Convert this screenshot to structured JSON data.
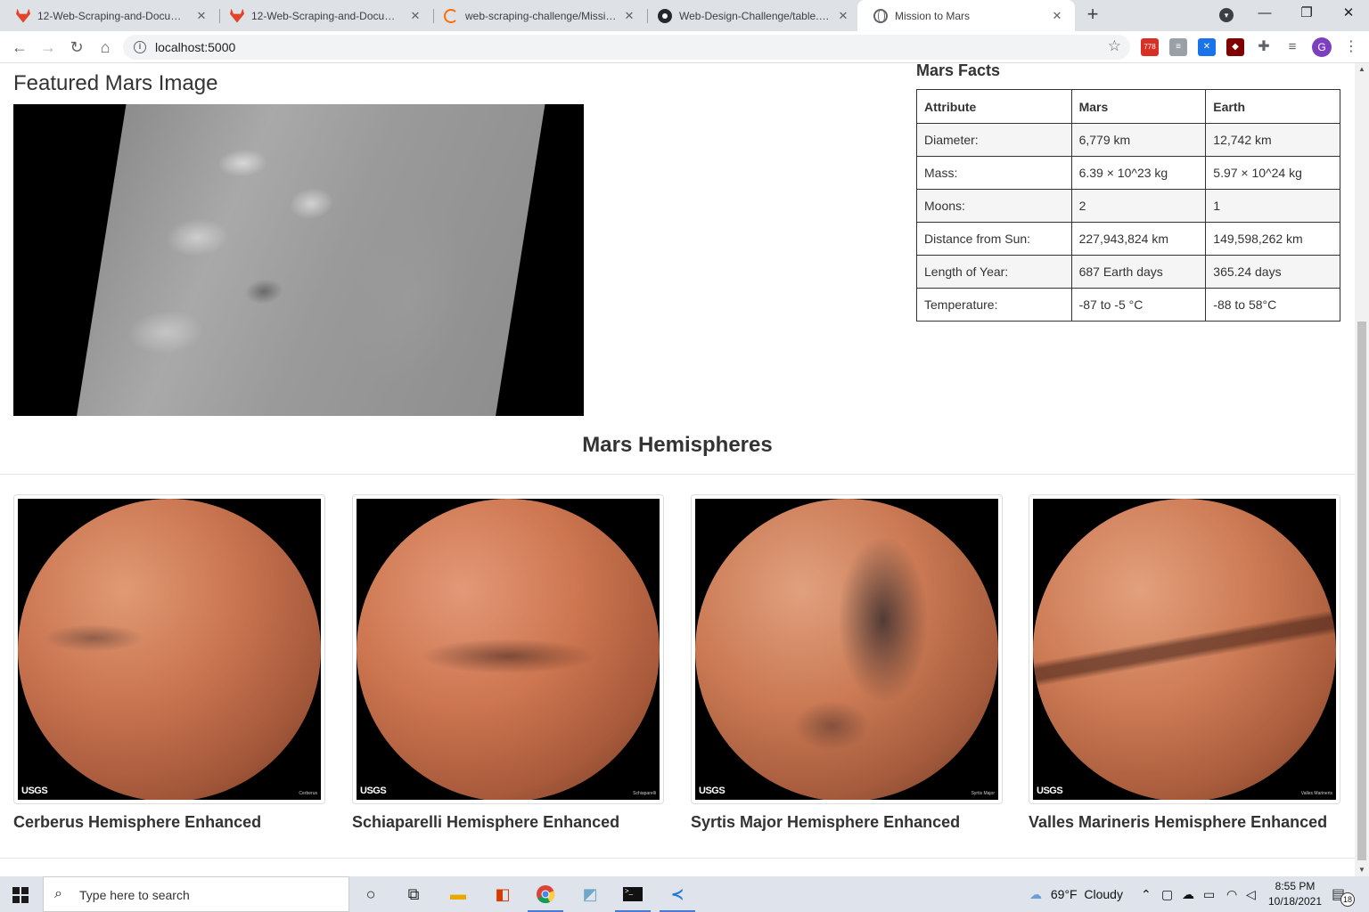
{
  "browser": {
    "tabs": [
      {
        "title": "12-Web-Scraping-and-Documen",
        "icon": "gitlab-icon",
        "active": false
      },
      {
        "title": "12-Web-Scraping-and-Documen",
        "icon": "gitlab-icon",
        "active": false
      },
      {
        "title": "web-scraping-challenge/Mission",
        "icon": "loading-spinner-icon",
        "active": false
      },
      {
        "title": "Web-Design-Challenge/table.htm",
        "icon": "github-icon",
        "active": false
      },
      {
        "title": "Mission to Mars",
        "icon": "globe-icon",
        "active": true
      }
    ],
    "url": "localhost:5000",
    "extension_badge": "778",
    "profile_initial": "G"
  },
  "page": {
    "featured": {
      "title": "Featured Mars Image"
    },
    "facts": {
      "title": "Mars Facts",
      "headers": [
        "Attribute",
        "Mars",
        "Earth"
      ],
      "rows": [
        [
          "Diameter:",
          "6,779 km",
          "12,742 km"
        ],
        [
          "Mass:",
          "6.39 × 10^23 kg",
          "5.97 × 10^24 kg"
        ],
        [
          "Moons:",
          "2",
          "1"
        ],
        [
          "Distance from Sun:",
          "227,943,824 km",
          "149,598,262 km"
        ],
        [
          "Length of Year:",
          "687 Earth days",
          "365.24 days"
        ],
        [
          "Temperature:",
          "-87 to -5 °C",
          "-88 to 58°C"
        ]
      ]
    },
    "hemispheres": {
      "title": "Mars Hemispheres",
      "items": [
        {
          "caption": "Cerberus Hemisphere Enhanced",
          "logo": "USGS",
          "credit": "Cerberus"
        },
        {
          "caption": "Schiaparelli Hemisphere Enhanced",
          "logo": "USGS",
          "credit": "Schiaparelli"
        },
        {
          "caption": "Syrtis Major Hemisphere Enhanced",
          "logo": "USGS",
          "credit": "Syrtis Major"
        },
        {
          "caption": "Valles Marineris Hemisphere Enhanced",
          "logo": "USGS",
          "credit": "Valles Marineris"
        }
      ]
    }
  },
  "taskbar": {
    "search_placeholder": "Type here to search",
    "weather": "69°F  Cloudy",
    "time": "8:55 PM",
    "date": "10/18/2021",
    "notification_count": "18"
  },
  "colors": {
    "tabbar": "#dee1e6",
    "taskbar": "#dfe4ec",
    "text": "#333333",
    "avatar": "#7b3fbf"
  }
}
